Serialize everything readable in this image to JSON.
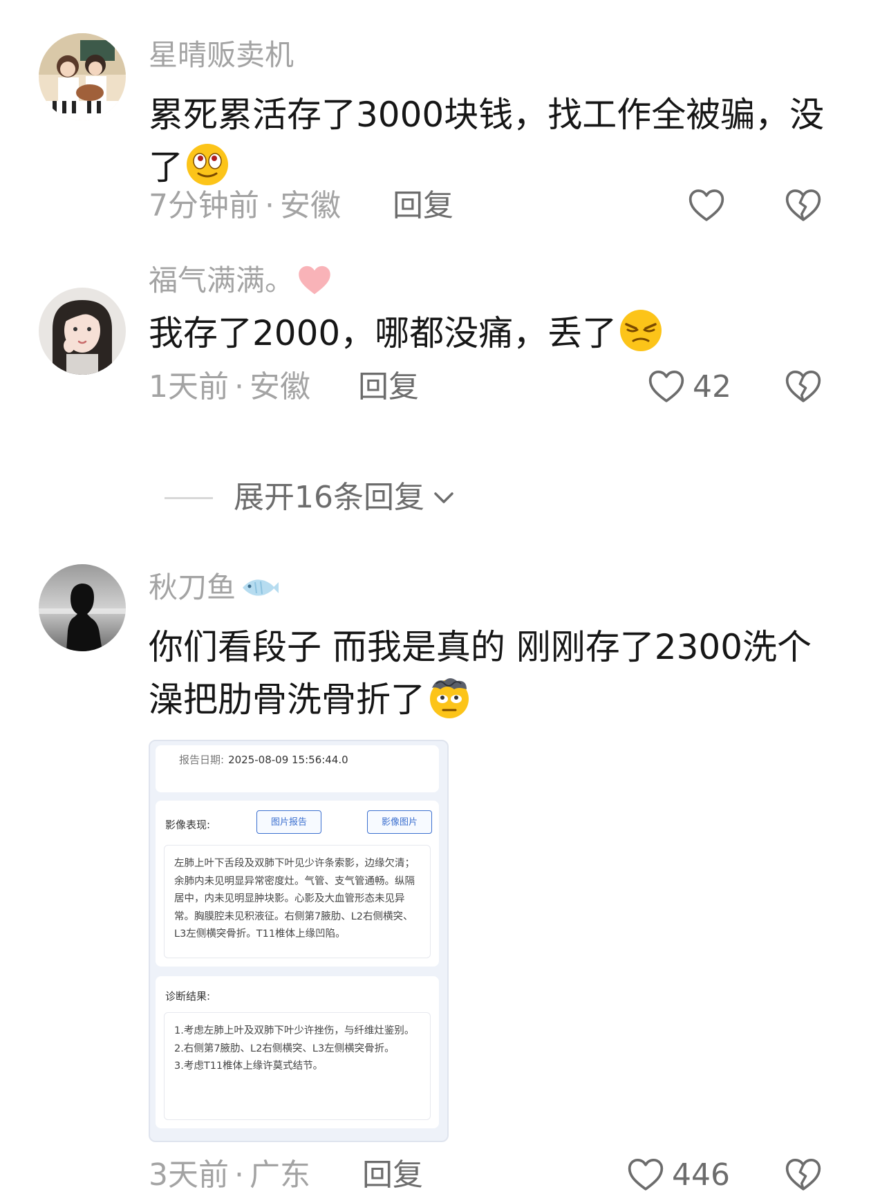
{
  "comments": [
    {
      "username": "星晴贩卖机",
      "text": "累死累活存了3000块钱，找工作全被骗，没了",
      "time": "7分钟前",
      "location": "安徽",
      "reply_label": "回复",
      "like_count": "",
      "text_emoji": "rolling-eyes-emoji",
      "avatar": "anime-couple-guitar-avatar"
    },
    {
      "username": "福气满满。",
      "name_emoji": "pink-heart-emoji",
      "text": "我存了2000，哪都没痛，丢了",
      "time": "1天前",
      "location": "安徽",
      "reply_label": "回复",
      "like_count": "42",
      "text_emoji": "annoyed-face-emoji",
      "avatar": "girl-portrait-avatar"
    },
    {
      "username": "秋刀鱼",
      "name_emoji": "fish-emoji",
      "text": "你们看段子 而我是真的 刚刚存了2300洗个澡把肋骨洗骨折了",
      "time": "3天前",
      "location": "广东",
      "reply_label": "回复",
      "like_count": "446",
      "text_emoji": "dizzy-face-emoji",
      "avatar": "silhouette-avatar"
    }
  ],
  "expand_replies": {
    "label": "展开16条回复"
  },
  "separator": "·",
  "report": {
    "date_label": "报告日期:",
    "date_value": "2025-08-09 15:56:44.0",
    "imaging_title": "影像表现:",
    "btn_image_report": "图片报告",
    "btn_image_pics": "影像图片",
    "findings": "左肺上叶下舌段及双肺下叶见少许条索影，边缘欠清；余肺内未见明显异常密度灶。气管、支气管通畅。纵隔居中，内未见明显肿块影。心影及大血管形态未见异常。胸膜腔未见积液征。右侧第7腋肋、L2右侧横突、L3左侧横突骨折。T11椎体上缘凹陷。",
    "diagnosis_title": "诊断结果:",
    "diagnosis": [
      "1.考虑左肺上叶及双肺下叶少许挫伤，与纤维灶鉴别。",
      "2.右侧第7腋肋、L2右侧横突、L3左侧横突骨折。",
      "3.考虑T11椎体上缘许莫式结节。"
    ]
  },
  "colors": {
    "meta_gray": "#a3a3a3",
    "text_dark": "#161616",
    "accent_blue": "#3b6fcf"
  }
}
